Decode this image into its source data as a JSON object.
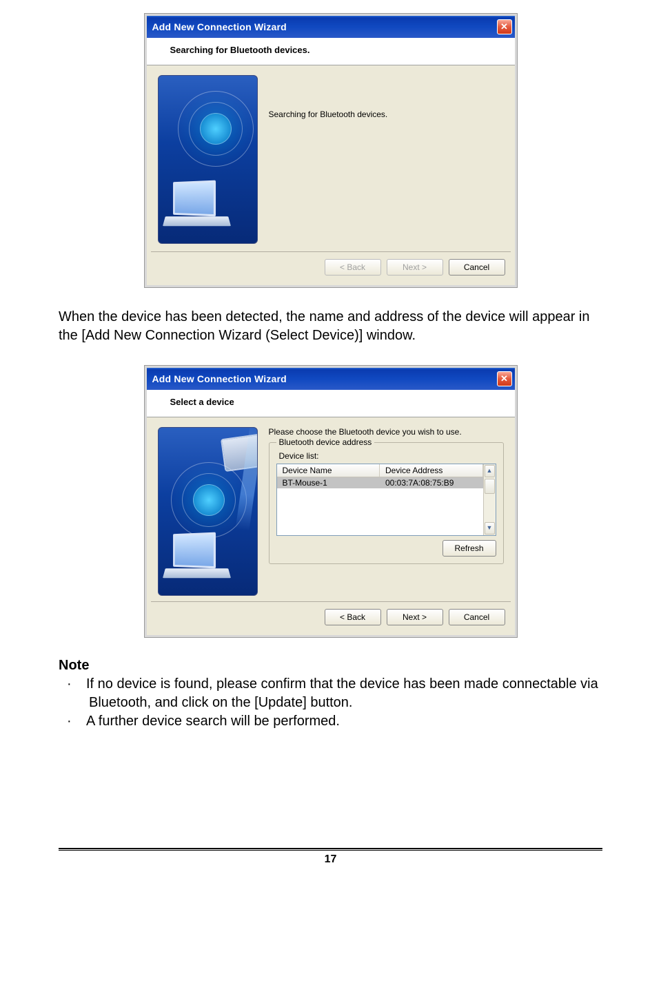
{
  "dialog1": {
    "title": "Add New Connection Wizard",
    "header": "Searching for Bluetooth devices.",
    "message": "Searching for Bluetooth devices.",
    "buttons": {
      "back": "< Back",
      "next": "Next >",
      "cancel": "Cancel"
    }
  },
  "para1": "When the device has been detected, the name and address of the device will appear in the [Add New Connection Wizard (Select Device)] window.",
  "dialog2": {
    "title": "Add New Connection Wizard",
    "header": "Select a device",
    "prompt": "Please choose the Bluetooth device you wish to use.",
    "group_title": "Bluetooth device address",
    "list_label": "Device list:",
    "columns": {
      "name": "Device Name",
      "addr": "Device Address"
    },
    "rows": [
      {
        "name": "BT-Mouse-1",
        "addr": "00:03:7A:08:75:B9"
      }
    ],
    "refresh": "Refresh",
    "buttons": {
      "back": "< Back",
      "next": "Next >",
      "cancel": "Cancel"
    }
  },
  "note": {
    "heading": "Note",
    "items": [
      "If no device is found, please confirm that the device has been made connectable via Bluetooth, and click on the [Update] button.",
      "A further device search will be performed."
    ]
  },
  "page_number": "17"
}
